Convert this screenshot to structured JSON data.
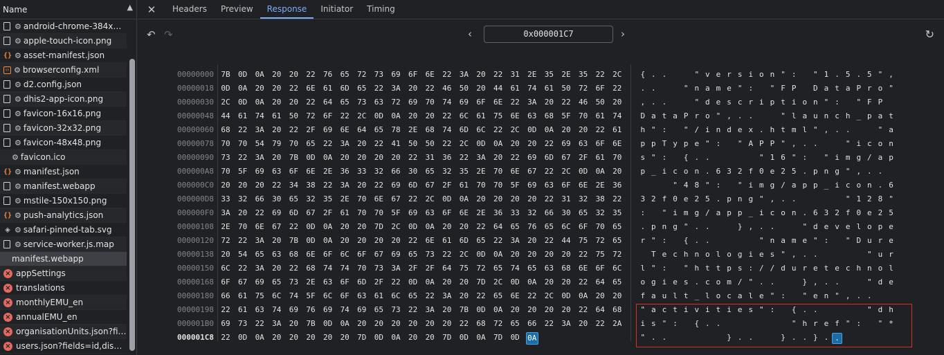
{
  "left_panel": {
    "header_label": "Name",
    "requests": [
      {
        "label": "android-chrome-384x384...",
        "icon": "doc",
        "gear": true
      },
      {
        "label": "apple-touch-icon.png",
        "icon": "doc",
        "gear": true
      },
      {
        "label": "asset-manifest.json",
        "icon": "json",
        "gear": true
      },
      {
        "label": "browserconfig.xml",
        "icon": "xml",
        "gear": true
      },
      {
        "label": "d2.config.json",
        "icon": "doc",
        "gear": true
      },
      {
        "label": "dhis2-app-icon.png",
        "icon": "doc",
        "gear": true
      },
      {
        "label": "favicon-16x16.png",
        "icon": "doc",
        "gear": true
      },
      {
        "label": "favicon-32x32.png",
        "icon": "doc",
        "gear": true
      },
      {
        "label": "favicon-48x48.png",
        "icon": "doc",
        "gear": true
      },
      {
        "label": "favicon.ico",
        "icon": "none",
        "gear": true
      },
      {
        "label": "manifest.json",
        "icon": "json",
        "gear": true
      },
      {
        "label": "manifest.webapp",
        "icon": "doc",
        "gear": true
      },
      {
        "label": "mstile-150x150.png",
        "icon": "doc",
        "gear": true
      },
      {
        "label": "push-analytics.json",
        "icon": "json",
        "gear": true
      },
      {
        "label": "safari-pinned-tab.svg",
        "icon": "svg",
        "gear": true
      },
      {
        "label": "service-worker.js.map",
        "icon": "doc",
        "gear": true
      },
      {
        "label": "manifest.webapp",
        "icon": "none",
        "gear": false,
        "selected": true
      },
      {
        "label": "appSettings",
        "icon": "err",
        "gear": false
      },
      {
        "label": "translations",
        "icon": "err",
        "gear": false
      },
      {
        "label": "monthlyEMU_en",
        "icon": "err",
        "gear": false
      },
      {
        "label": "annualEMU_en",
        "icon": "err",
        "gear": false
      },
      {
        "label": "organisationUnits.json?field...",
        "icon": "err",
        "gear": false
      },
      {
        "label": "users.json?fields=id,display...",
        "icon": "err",
        "gear": false
      }
    ]
  },
  "tabs": [
    {
      "label": "Headers",
      "active": false
    },
    {
      "label": "Preview",
      "active": false
    },
    {
      "label": "Response",
      "active": true
    },
    {
      "label": "Initiator",
      "active": false
    },
    {
      "label": "Timing",
      "active": false
    }
  ],
  "toolbar": {
    "offset_value": "0x000001C7"
  },
  "colors": {
    "accent": "#7cacf8",
    "error": "#e46962",
    "selection_border": "#d93025",
    "highlight": "#1a6ea8"
  },
  "hex_view": {
    "current_row": 19,
    "highlight_byte": {
      "row": 19,
      "col": 15
    },
    "highlight_char": {
      "row": 19,
      "col": 15
    },
    "rows": [
      {
        "addr": "00000000",
        "bytes": [
          "7B",
          "0D",
          "0A",
          "20",
          "20",
          "22",
          "76",
          "65",
          "72",
          "73",
          "69",
          "6F",
          "6E",
          "22",
          "3A",
          "20",
          "22",
          "31",
          "2E",
          "35",
          "2E",
          "35",
          "22",
          "2C"
        ],
        "chars": [
          "{",
          ".",
          ".",
          " ",
          " ",
          "\"",
          "v",
          "e",
          "r",
          "s",
          "i",
          "o",
          "n",
          "\"",
          ":",
          " ",
          "\"",
          "1",
          ".",
          "5",
          ".",
          "5",
          "\"",
          ","
        ]
      },
      {
        "addr": "00000018",
        "bytes": [
          "0D",
          "0A",
          "20",
          "20",
          "22",
          "6E",
          "61",
          "6D",
          "65",
          "22",
          "3A",
          "20",
          "22",
          "46",
          "50",
          "20",
          "44",
          "61",
          "74",
          "61",
          "50",
          "72",
          "6F",
          "22"
        ],
        "chars": [
          ".",
          ".",
          " ",
          " ",
          "\"",
          "n",
          "a",
          "m",
          "e",
          "\"",
          ":",
          " ",
          "\"",
          "F",
          "P",
          " ",
          "D",
          "a",
          "t",
          "a",
          "P",
          "r",
          "o",
          "\""
        ]
      },
      {
        "addr": "00000030",
        "bytes": [
          "2C",
          "0D",
          "0A",
          "20",
          "20",
          "22",
          "64",
          "65",
          "73",
          "63",
          "72",
          "69",
          "70",
          "74",
          "69",
          "6F",
          "6E",
          "22",
          "3A",
          "20",
          "22",
          "46",
          "50",
          "20"
        ],
        "chars": [
          ",",
          ".",
          ".",
          " ",
          " ",
          "\"",
          "d",
          "e",
          "s",
          "c",
          "r",
          "i",
          "p",
          "t",
          "i",
          "o",
          "n",
          "\"",
          ":",
          " ",
          "\"",
          "F",
          "P",
          " "
        ]
      },
      {
        "addr": "00000048",
        "bytes": [
          "44",
          "61",
          "74",
          "61",
          "50",
          "72",
          "6F",
          "22",
          "2C",
          "0D",
          "0A",
          "20",
          "20",
          "22",
          "6C",
          "61",
          "75",
          "6E",
          "63",
          "68",
          "5F",
          "70",
          "61",
          "74"
        ],
        "chars": [
          "D",
          "a",
          "t",
          "a",
          "P",
          "r",
          "o",
          "\"",
          ",",
          ".",
          ".",
          " ",
          " ",
          "\"",
          "l",
          "a",
          "u",
          "n",
          "c",
          "h",
          "_",
          "p",
          "a",
          "t"
        ]
      },
      {
        "addr": "00000060",
        "bytes": [
          "68",
          "22",
          "3A",
          "20",
          "22",
          "2F",
          "69",
          "6E",
          "64",
          "65",
          "78",
          "2E",
          "68",
          "74",
          "6D",
          "6C",
          "22",
          "2C",
          "0D",
          "0A",
          "20",
          "20",
          "22",
          "61"
        ],
        "chars": [
          "h",
          "\"",
          ":",
          " ",
          "\"",
          "/",
          "i",
          "n",
          "d",
          "e",
          "x",
          ".",
          "h",
          "t",
          "m",
          "l",
          "\"",
          ",",
          ".",
          ".",
          " ",
          " ",
          "\"",
          "a"
        ]
      },
      {
        "addr": "00000078",
        "bytes": [
          "70",
          "70",
          "54",
          "79",
          "70",
          "65",
          "22",
          "3A",
          "20",
          "22",
          "41",
          "50",
          "50",
          "22",
          "2C",
          "0D",
          "0A",
          "20",
          "20",
          "22",
          "69",
          "63",
          "6F",
          "6E"
        ],
        "chars": [
          "p",
          "p",
          "T",
          "y",
          "p",
          "e",
          "\"",
          ":",
          " ",
          "\"",
          "A",
          "P",
          "P",
          "\"",
          ",",
          ".",
          ".",
          " ",
          " ",
          "\"",
          "i",
          "c",
          "o",
          "n"
        ]
      },
      {
        "addr": "00000090",
        "bytes": [
          "73",
          "22",
          "3A",
          "20",
          "7B",
          "0D",
          "0A",
          "20",
          "20",
          "20",
          "20",
          "22",
          "31",
          "36",
          "22",
          "3A",
          "20",
          "22",
          "69",
          "6D",
          "67",
          "2F",
          "61",
          "70"
        ],
        "chars": [
          "s",
          "\"",
          ":",
          " ",
          "{",
          ".",
          ".",
          " ",
          " ",
          " ",
          " ",
          "\"",
          "1",
          "6",
          "\"",
          ":",
          " ",
          "\"",
          "i",
          "m",
          "g",
          "/",
          "a",
          "p"
        ]
      },
      {
        "addr": "000000A8",
        "bytes": [
          "70",
          "5F",
          "69",
          "63",
          "6F",
          "6E",
          "2E",
          "36",
          "33",
          "32",
          "66",
          "30",
          "65",
          "32",
          "35",
          "2E",
          "70",
          "6E",
          "67",
          "22",
          "2C",
          "0D",
          "0A",
          "20"
        ],
        "chars": [
          "p",
          "_",
          "i",
          "c",
          "o",
          "n",
          ".",
          "6",
          "3",
          "2",
          "f",
          "0",
          "e",
          "2",
          "5",
          ".",
          "p",
          "n",
          "g",
          "\"",
          ",",
          ".",
          ".",
          " "
        ]
      },
      {
        "addr": "000000C0",
        "bytes": [
          "20",
          "20",
          "20",
          "22",
          "34",
          "38",
          "22",
          "3A",
          "20",
          "22",
          "69",
          "6D",
          "67",
          "2F",
          "61",
          "70",
          "70",
          "5F",
          "69",
          "63",
          "6F",
          "6E",
          "2E",
          "36"
        ],
        "chars": [
          " ",
          " ",
          " ",
          "\"",
          "4",
          "8",
          "\"",
          ":",
          " ",
          "\"",
          "i",
          "m",
          "g",
          "/",
          "a",
          "p",
          "p",
          "_",
          "i",
          "c",
          "o",
          "n",
          ".",
          "6"
        ]
      },
      {
        "addr": "000000D8",
        "bytes": [
          "33",
          "32",
          "66",
          "30",
          "65",
          "32",
          "35",
          "2E",
          "70",
          "6E",
          "67",
          "22",
          "2C",
          "0D",
          "0A",
          "20",
          "20",
          "20",
          "20",
          "22",
          "31",
          "32",
          "38",
          "22"
        ],
        "chars": [
          "3",
          "2",
          "f",
          "0",
          "e",
          "2",
          "5",
          ".",
          "p",
          "n",
          "g",
          "\"",
          ",",
          ".",
          ".",
          " ",
          " ",
          " ",
          " ",
          "\"",
          "1",
          "2",
          "8",
          "\""
        ]
      },
      {
        "addr": "000000F0",
        "bytes": [
          "3A",
          "20",
          "22",
          "69",
          "6D",
          "67",
          "2F",
          "61",
          "70",
          "70",
          "5F",
          "69",
          "63",
          "6F",
          "6E",
          "2E",
          "36",
          "33",
          "32",
          "66",
          "30",
          "65",
          "32",
          "35"
        ],
        "chars": [
          ":",
          " ",
          "\"",
          "i",
          "m",
          "g",
          "/",
          "a",
          "p",
          "p",
          "_",
          "i",
          "c",
          "o",
          "n",
          ".",
          "6",
          "3",
          "2",
          "f",
          "0",
          "e",
          "2",
          "5"
        ]
      },
      {
        "addr": "00000108",
        "bytes": [
          "2E",
          "70",
          "6E",
          "67",
          "22",
          "0D",
          "0A",
          "20",
          "20",
          "7D",
          "2C",
          "0D",
          "0A",
          "20",
          "20",
          "22",
          "64",
          "65",
          "76",
          "65",
          "6C",
          "6F",
          "70",
          "65"
        ],
        "chars": [
          ".",
          "p",
          "n",
          "g",
          "\"",
          ".",
          ".",
          " ",
          " ",
          "}",
          ",",
          ".",
          ".",
          " ",
          " ",
          "\"",
          "d",
          "e",
          "v",
          "e",
          "l",
          "o",
          "p",
          "e"
        ]
      },
      {
        "addr": "00000120",
        "bytes": [
          "72",
          "22",
          "3A",
          "20",
          "7B",
          "0D",
          "0A",
          "20",
          "20",
          "20",
          "20",
          "22",
          "6E",
          "61",
          "6D",
          "65",
          "22",
          "3A",
          "20",
          "22",
          "44",
          "75",
          "72",
          "65"
        ],
        "chars": [
          "r",
          "\"",
          ":",
          " ",
          "{",
          ".",
          ".",
          " ",
          " ",
          " ",
          " ",
          "\"",
          "n",
          "a",
          "m",
          "e",
          "\"",
          ":",
          " ",
          "\"",
          "D",
          "u",
          "r",
          "e"
        ]
      },
      {
        "addr": "00000138",
        "bytes": [
          "20",
          "54",
          "65",
          "63",
          "68",
          "6E",
          "6F",
          "6C",
          "6F",
          "67",
          "69",
          "65",
          "73",
          "22",
          "2C",
          "0D",
          "0A",
          "20",
          "20",
          "20",
          "20",
          "22",
          "75",
          "72"
        ],
        "chars": [
          " ",
          "T",
          "e",
          "c",
          "h",
          "n",
          "o",
          "l",
          "o",
          "g",
          "i",
          "e",
          "s",
          "\"",
          ",",
          ".",
          ".",
          " ",
          " ",
          " ",
          " ",
          "\"",
          "u",
          "r"
        ]
      },
      {
        "addr": "00000150",
        "bytes": [
          "6C",
          "22",
          "3A",
          "20",
          "22",
          "68",
          "74",
          "74",
          "70",
          "73",
          "3A",
          "2F",
          "2F",
          "64",
          "75",
          "72",
          "65",
          "74",
          "65",
          "63",
          "68",
          "6E",
          "6F",
          "6C"
        ],
        "chars": [
          "l",
          "\"",
          ":",
          " ",
          "\"",
          "h",
          "t",
          "t",
          "p",
          "s",
          ":",
          "/",
          "/",
          "d",
          "u",
          "r",
          "e",
          "t",
          "e",
          "c",
          "h",
          "n",
          "o",
          "l"
        ]
      },
      {
        "addr": "00000168",
        "bytes": [
          "6F",
          "67",
          "69",
          "65",
          "73",
          "2E",
          "63",
          "6F",
          "6D",
          "2F",
          "22",
          "0D",
          "0A",
          "20",
          "20",
          "7D",
          "2C",
          "0D",
          "0A",
          "20",
          "20",
          "22",
          "64",
          "65"
        ],
        "chars": [
          "o",
          "g",
          "i",
          "e",
          "s",
          ".",
          "c",
          "o",
          "m",
          "/",
          "\"",
          ".",
          ".",
          " ",
          " ",
          "}",
          ",",
          ".",
          ".",
          " ",
          " ",
          "\"",
          "d",
          "e"
        ]
      },
      {
        "addr": "00000180",
        "bytes": [
          "66",
          "61",
          "75",
          "6C",
          "74",
          "5F",
          "6C",
          "6F",
          "63",
          "61",
          "6C",
          "65",
          "22",
          "3A",
          "20",
          "22",
          "65",
          "6E",
          "22",
          "2C",
          "0D",
          "0A",
          "20",
          "20"
        ],
        "chars": [
          "f",
          "a",
          "u",
          "l",
          "t",
          "_",
          "l",
          "o",
          "c",
          "a",
          "l",
          "e",
          "\"",
          ":",
          " ",
          "\"",
          "e",
          "n",
          "\"",
          ",",
          ".",
          ".",
          " ",
          " "
        ]
      },
      {
        "addr": "00000198",
        "bytes": [
          "22",
          "61",
          "63",
          "74",
          "69",
          "76",
          "69",
          "74",
          "69",
          "65",
          "73",
          "22",
          "3A",
          "20",
          "7B",
          "0D",
          "0A",
          "20",
          "20",
          "20",
          "20",
          "22",
          "64",
          "68"
        ],
        "chars": [
          "\"",
          "a",
          "c",
          "t",
          "i",
          "v",
          "i",
          "t",
          "i",
          "e",
          "s",
          "\"",
          ":",
          " ",
          "{",
          ".",
          ".",
          " ",
          " ",
          " ",
          " ",
          "\"",
          "d",
          "h"
        ]
      },
      {
        "addr": "000001B0",
        "bytes": [
          "69",
          "73",
          "22",
          "3A",
          "20",
          "7B",
          "0D",
          "0A",
          "20",
          "20",
          "20",
          "20",
          "20",
          "20",
          "22",
          "68",
          "72",
          "65",
          "66",
          "22",
          "3A",
          "20",
          "22",
          "2A"
        ],
        "chars": [
          "i",
          "s",
          "\"",
          ":",
          " ",
          "{",
          ".",
          ".",
          " ",
          " ",
          " ",
          " ",
          " ",
          " ",
          "\"",
          "h",
          "r",
          "e",
          "f",
          "\"",
          ":",
          " ",
          "\"",
          "*"
        ]
      },
      {
        "addr": "000001C8",
        "bytes": [
          "22",
          "0D",
          "0A",
          "20",
          "20",
          "20",
          "20",
          "20",
          "7D",
          "0D",
          "0A",
          "20",
          "20",
          "7D",
          "0D",
          "0A",
          "7D",
          "0D",
          "0A"
        ],
        "chars": [
          "\"",
          ".",
          ".",
          " ",
          " ",
          " ",
          " ",
          " ",
          "}",
          ".",
          ".",
          " ",
          " ",
          "}",
          ".",
          ".",
          "}",
          ".",
          "."
        ]
      }
    ]
  }
}
